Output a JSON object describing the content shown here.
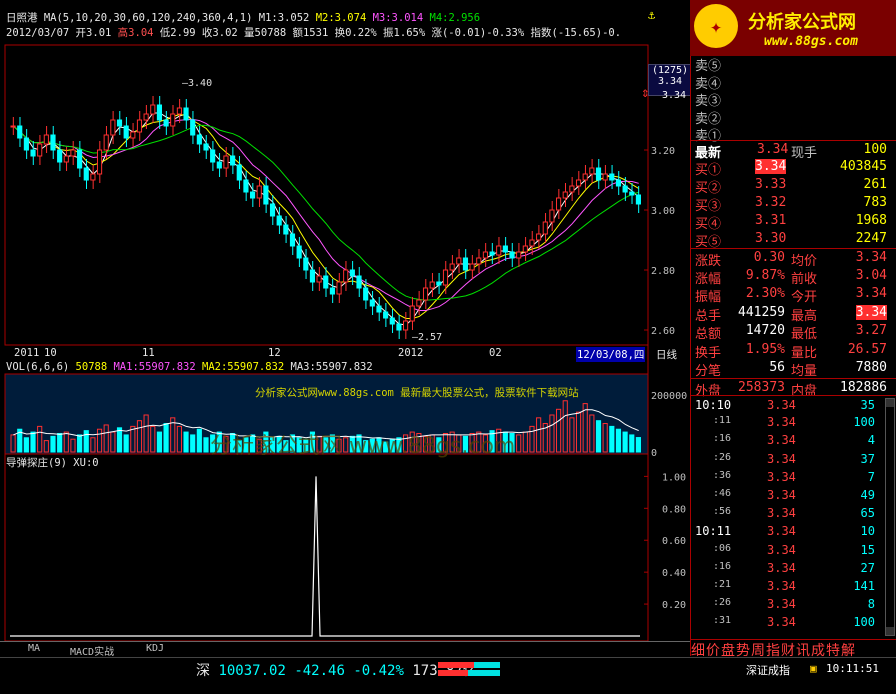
{
  "header": {
    "stock_name": "日照港",
    "ma_line": "MA(5,10,20,30,60,120,240,360,4,1)",
    "m1": "M1:3.052",
    "m2": "M2:3.074",
    "m3": "M3:3.014",
    "m4": "M4:2.956",
    "date": "2012/03/07",
    "open": "开3.01",
    "high": "高3.04",
    "low": "低2.99",
    "close": "收3.02",
    "volume": "量50788",
    "amount": "额1531",
    "turnover": "换0.22%",
    "amplitude": "振1.65%",
    "change": "涨(-0.01)-0.33%",
    "index": "指数(-15.65)-0."
  },
  "chart_data": {
    "type": "line",
    "price_axis_ticks": [
      "3.20",
      "3.00",
      "2.80",
      "2.60"
    ],
    "price_ylim": [
      2.55,
      3.55
    ],
    "annotations": {
      "high": "3.40",
      "low": "2.57",
      "price_tag_count": "(1275)",
      "price_tag_value": "3.34",
      "price_tag_right": "3.34"
    },
    "x_labels": [
      "2011",
      "10",
      "11",
      "12",
      "2012",
      "02"
    ],
    "cursor_date": "12/03/08,四",
    "period": "日线",
    "closes": [
      3.28,
      3.24,
      3.2,
      3.18,
      3.22,
      3.25,
      3.2,
      3.16,
      3.18,
      3.2,
      3.14,
      3.1,
      3.12,
      3.2,
      3.25,
      3.3,
      3.28,
      3.24,
      3.26,
      3.3,
      3.32,
      3.35,
      3.3,
      3.28,
      3.32,
      3.34,
      3.3,
      3.25,
      3.22,
      3.2,
      3.16,
      3.14,
      3.18,
      3.15,
      3.1,
      3.06,
      3.04,
      3.08,
      3.02,
      2.98,
      2.95,
      2.92,
      2.88,
      2.84,
      2.8,
      2.76,
      2.78,
      2.74,
      2.72,
      2.76,
      2.8,
      2.78,
      2.74,
      2.7,
      2.68,
      2.66,
      2.64,
      2.62,
      2.6,
      2.63,
      2.68,
      2.7,
      2.74,
      2.76,
      2.75,
      2.8,
      2.82,
      2.84,
      2.8,
      2.82,
      2.84,
      2.86,
      2.85,
      2.88,
      2.86,
      2.84,
      2.86,
      2.88,
      2.9,
      2.92,
      2.96,
      3.0,
      3.04,
      3.06,
      3.08,
      3.1,
      3.12,
      3.14,
      3.1,
      3.12,
      3.1,
      3.08,
      3.06,
      3.05,
      3.02
    ],
    "vol_title": "VOL(6,6,6)",
    "vol_value": "50788",
    "vol_ma1": "MA1:55907.832",
    "vol_ma2": "MA2:55907.832",
    "vol_ma3": "MA3:55907.832",
    "vol_ticks": [
      "200000",
      "0"
    ],
    "vol_values": [
      60000,
      80000,
      50000,
      70000,
      90000,
      40000,
      55000,
      65000,
      70000,
      45000,
      60000,
      75000,
      50000,
      80000,
      95000,
      70000,
      85000,
      60000,
      90000,
      110000,
      130000,
      90000,
      70000,
      100000,
      120000,
      90000,
      70000,
      60000,
      80000,
      50000,
      60000,
      70000,
      55000,
      65000,
      40000,
      50000,
      60000,
      45000,
      70000,
      50000,
      55000,
      40000,
      60000,
      50000,
      45000,
      70000,
      55000,
      50000,
      60000,
      45000,
      50000,
      55000,
      60000,
      40000,
      45000,
      50000,
      35000,
      45000,
      50000,
      60000,
      70000,
      65000,
      55000,
      60000,
      50000,
      65000,
      70000,
      60000,
      55000,
      65000,
      70000,
      60000,
      75000,
      80000,
      70000,
      65000,
      60000,
      70000,
      90000,
      120000,
      100000,
      130000,
      150000,
      180000,
      120000,
      140000,
      170000,
      130000,
      110000,
      100000,
      90000,
      80000,
      70000,
      60000,
      50788
    ],
    "watermark1": "分析家公式网www.88gs.com 最新最大股票公式，股票软件下载网站",
    "watermark2": "分析家公式网 www.88gs.com",
    "ind_title": "导弹探庄(9)",
    "ind_value": "XU:0",
    "ind_ticks": [
      "1.00",
      "0.80",
      "0.60",
      "0.40",
      "0.20"
    ],
    "ind_spike": 1.0
  },
  "logo": {
    "text": "分析家公式网",
    "url": "www.88gs.com"
  },
  "orderbook": {
    "sells": [
      "卖⑤",
      "卖④",
      "卖③",
      "卖②",
      "卖①"
    ],
    "latest_label": "最新",
    "latest": "3.34",
    "now_hand_label": "现手",
    "now_hand": "100",
    "buys": [
      {
        "label": "买①",
        "price": "3.34",
        "vol": "403845"
      },
      {
        "label": "买②",
        "price": "3.33",
        "vol": "261"
      },
      {
        "label": "买③",
        "price": "3.32",
        "vol": "783"
      },
      {
        "label": "买④",
        "price": "3.31",
        "vol": "1968"
      },
      {
        "label": "买⑤",
        "price": "3.30",
        "vol": "2247"
      }
    ]
  },
  "stats": [
    {
      "l1": "涨跌",
      "v1": "0.30",
      "l2": "均价",
      "v2": "3.34"
    },
    {
      "l1": "涨幅",
      "v1": "9.87%",
      "l2": "前收",
      "v2": "3.04"
    },
    {
      "l1": "振幅",
      "v1": "2.30%",
      "l2": "今开",
      "v2": "3.34"
    },
    {
      "l1": "总手",
      "v1": "441259",
      "l2": "最高",
      "v2": "3.34"
    },
    {
      "l1": "总额",
      "v1": "14720",
      "l2": "最低",
      "v2": "3.27"
    },
    {
      "l1": "换手",
      "v1": "1.95%",
      "l2": "量比",
      "v2": "26.57"
    },
    {
      "l1": "分笔",
      "v1": "56",
      "l2": "均量",
      "v2": "7880"
    },
    {
      "l1": "外盘",
      "v1": "258373",
      "l2": "内盘",
      "v2": "182886"
    }
  ],
  "ticks": [
    {
      "t": "10:10",
      "p": "3.34",
      "v": "35"
    },
    {
      "t": ":11",
      "p": "3.34",
      "v": "100"
    },
    {
      "t": ":16",
      "p": "3.34",
      "v": "4"
    },
    {
      "t": ":26",
      "p": "3.34",
      "v": "37"
    },
    {
      "t": ":36",
      "p": "3.34",
      "v": "7"
    },
    {
      "t": ":46",
      "p": "3.34",
      "v": "49"
    },
    {
      "t": ":56",
      "p": "3.34",
      "v": "65"
    },
    {
      "t": "10:11",
      "p": "3.34",
      "v": "10"
    },
    {
      "t": ":06",
      "p": "3.34",
      "v": "15"
    },
    {
      "t": ":16",
      "p": "3.34",
      "v": "27"
    },
    {
      "t": ":21",
      "p": "3.34",
      "v": "141"
    },
    {
      "t": ":26",
      "p": "3.34",
      "v": "8"
    },
    {
      "t": ":31",
      "p": "3.34",
      "v": "100"
    }
  ],
  "panel_tabs": "细价盘势周指财讯成特解",
  "bottom_tabs": [
    "MA",
    "MACD实战",
    "KDJ"
  ],
  "status": {
    "market": "深",
    "index": "10037.02",
    "change": "-42.46",
    "pct": "-0.42%",
    "amount": "173.87亿",
    "ticker": "深证成指",
    "time": "10:11:51"
  }
}
